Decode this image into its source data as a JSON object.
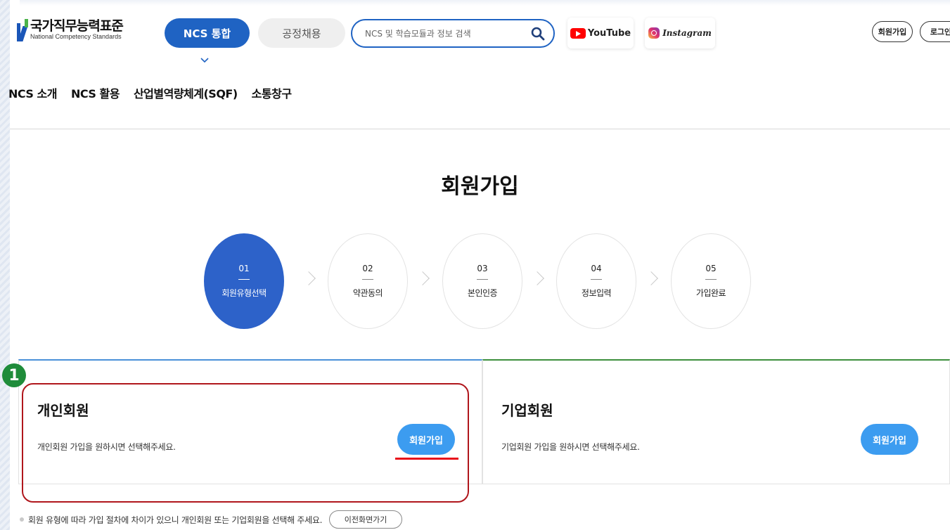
{
  "header": {
    "logo": {
      "ko": "국가직무능력표준",
      "en": "National Competency Standards"
    },
    "tabs": {
      "ncs": "NCS 통합",
      "recruit": "공정채용"
    },
    "search": {
      "placeholder": "NCS 및 학습모듈과 정보 검색",
      "value": ""
    },
    "sns": {
      "youtube": "YouTube",
      "instagram": "Instagram"
    },
    "auth": {
      "join": "회원가입",
      "login": "로그인"
    }
  },
  "gnb": [
    "NCS 소개",
    "NCS 활용",
    "산업별역량체계(SQF)",
    "소통창구"
  ],
  "page_title": "회원가입",
  "steps": [
    {
      "num": "01",
      "label": "회원유형선택",
      "active": true
    },
    {
      "num": "02",
      "label": "약관동의",
      "active": false
    },
    {
      "num": "03",
      "label": "본인인증",
      "active": false
    },
    {
      "num": "04",
      "label": "정보입력",
      "active": false
    },
    {
      "num": "05",
      "label": "가입완료",
      "active": false
    }
  ],
  "cards": {
    "personal": {
      "title": "개인회원",
      "desc": "개인회원 가입을 원하시면 선택해주세요.",
      "button": "회원가입"
    },
    "business": {
      "title": "기업회원",
      "desc": "기업회원 가입을 원하시면 선택해주세요.",
      "button": "회원가입"
    }
  },
  "annotation": {
    "badge": "1"
  },
  "note": {
    "text": "회원 유형에 따라 가입 절차에 차이가 있으니 개인회원 또는 기업회원을 선택해 주세요.",
    "back_button": "이전화면가기"
  },
  "colors": {
    "primary": "#1f63c3",
    "step_active": "#2d62c9",
    "join_button": "#3c9cf0",
    "highlight": "#b0161c"
  }
}
